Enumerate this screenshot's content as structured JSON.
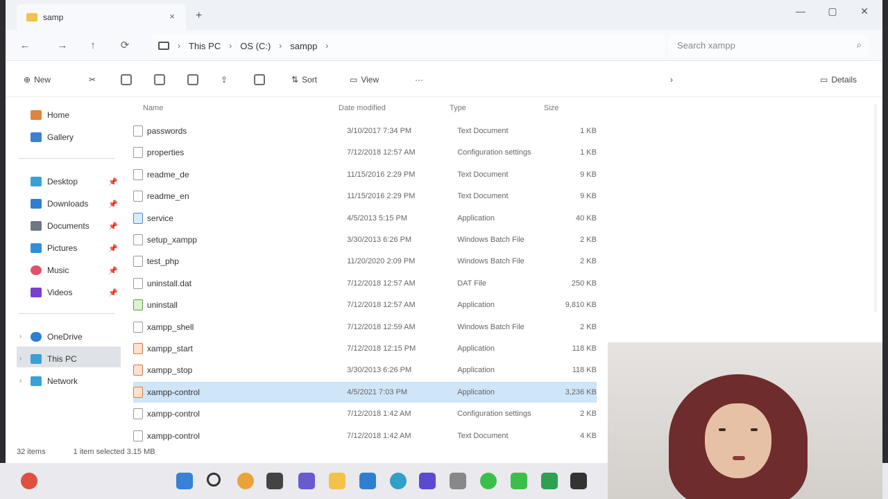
{
  "window": {
    "tab_title": "samp",
    "close_tab": "×",
    "new_tab": "+",
    "min": "—",
    "max": "▢",
    "close": "✕"
  },
  "nav": {
    "back": "←",
    "forward": "→",
    "up": "↑",
    "refresh": "⟳",
    "breadcrumbs": [
      "This PC",
      "OS (C:)",
      "sampp"
    ],
    "search_placeholder": "Search xampp",
    "search_icon": "⌕"
  },
  "toolbar": {
    "new_label": "New",
    "sort_label": "Sort",
    "view_label": "View",
    "more_label": "···",
    "details_label": "Details",
    "chevron": "›"
  },
  "sidebar": {
    "quick": [
      {
        "label": "Home",
        "color": "#e0843a"
      },
      {
        "label": "Gallery",
        "color": "#3e7fd0"
      }
    ],
    "pinned": [
      {
        "label": "Desktop",
        "color": "#3aa0d8"
      },
      {
        "label": "Downloads",
        "color": "#2f7fd0"
      },
      {
        "label": "Documents",
        "color": "#6d7a86"
      },
      {
        "label": "Pictures",
        "color": "#2f8fd8"
      },
      {
        "label": "Music",
        "color": "#e0506a"
      },
      {
        "label": "Videos",
        "color": "#7a3ed0"
      }
    ],
    "pin_icon": "📌",
    "drives": [
      {
        "label": "OneDrive",
        "color": "#2f7fd0"
      },
      {
        "label": "This PC",
        "color": "#3aa0d8"
      },
      {
        "label": "Network",
        "color": "#3aa0d8"
      }
    ],
    "expander": "›"
  },
  "columns": {
    "name": "Name",
    "date": "Date modified",
    "type": "Type",
    "size": "Size"
  },
  "files": [
    {
      "name": "passwords",
      "date": "3/10/2017 7:34 PM",
      "type": "Text Document",
      "size": "1 KB",
      "icon": "doc"
    },
    {
      "name": "properties",
      "date": "7/12/2018 12:57 AM",
      "type": "Configuration settings",
      "size": "1 KB",
      "icon": "doc"
    },
    {
      "name": "readme_de",
      "date": "11/15/2016 2:29 PM",
      "type": "Text Document",
      "size": "9 KB",
      "icon": "doc"
    },
    {
      "name": "readme_en",
      "date": "11/15/2016 2:29 PM",
      "type": "Text Document",
      "size": "9 KB",
      "icon": "doc"
    },
    {
      "name": "service",
      "date": "4/5/2013 5:15 PM",
      "type": "Application",
      "size": "40 KB",
      "icon": "exe"
    },
    {
      "name": "setup_xampp",
      "date": "3/30/2013 6:26 PM",
      "type": "Windows Batch File",
      "size": "2 KB",
      "icon": "doc"
    },
    {
      "name": "test_php",
      "date": "11/20/2020 2:09 PM",
      "type": "Windows Batch File",
      "size": "2 KB",
      "icon": "doc"
    },
    {
      "name": "uninstall.dat",
      "date": "7/12/2018 12:57 AM",
      "type": "DAT File",
      "size": "250 KB",
      "icon": "doc"
    },
    {
      "name": "uninstall",
      "date": "7/12/2018 12:57 AM",
      "type": "Application",
      "size": "9,810 KB",
      "icon": "green"
    },
    {
      "name": "xampp_shell",
      "date": "7/12/2018 12:59 AM",
      "type": "Windows Batch File",
      "size": "2 KB",
      "icon": "doc"
    },
    {
      "name": "xampp_start",
      "date": "7/12/2018 12:15 PM",
      "type": "Application",
      "size": "118 KB",
      "icon": "app"
    },
    {
      "name": "xampp_stop",
      "date": "3/30/2013 6:26 PM",
      "type": "Application",
      "size": "118 KB",
      "icon": "app"
    },
    {
      "name": "xampp-control",
      "date": "4/5/2021 7:03 PM",
      "type": "Application",
      "size": "3,236 KB",
      "icon": "app",
      "selected": true
    },
    {
      "name": "xampp-control",
      "date": "7/12/2018 1:42 AM",
      "type": "Configuration settings",
      "size": "2 KB",
      "icon": "doc"
    },
    {
      "name": "xampp-control",
      "date": "7/12/2018 1:42 AM",
      "type": "Text Document",
      "size": "4 KB",
      "icon": "doc"
    }
  ],
  "status": {
    "items": "32 items",
    "selected": "1 item selected  3.15 MB"
  }
}
